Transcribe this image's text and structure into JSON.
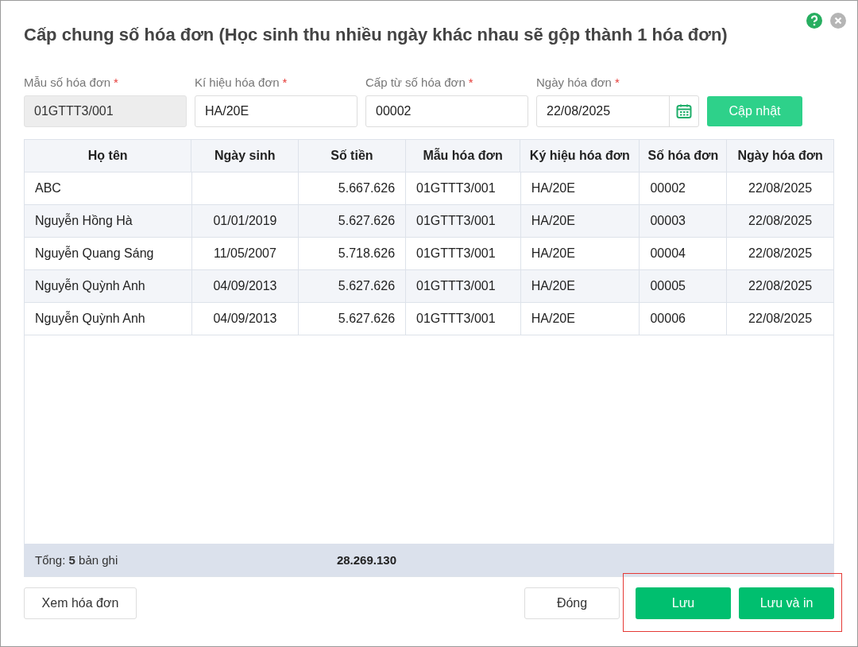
{
  "dialog": {
    "title": "Cấp chung số hóa đơn (Học sinh thu nhiều ngày khác nhau sẽ gộp thành 1 hóa đơn)"
  },
  "fields": [
    {
      "label": "Mẫu số hóa đơn",
      "required_mark": "*",
      "value": "01GTTT3/001",
      "disabled": true,
      "kind": "text"
    },
    {
      "label": "Kí hiệu hóa đơn",
      "required_mark": "*",
      "value": "HA/20E",
      "disabled": false,
      "kind": "text"
    },
    {
      "label": "Cấp từ số hóa đơn",
      "required_mark": "*",
      "value": "00002",
      "disabled": false,
      "kind": "text"
    },
    {
      "label": "Ngày hóa đơn",
      "required_mark": "*",
      "value": "22/08/2025",
      "disabled": false,
      "kind": "date"
    }
  ],
  "update_button": "Cập nhật",
  "table": {
    "columns": [
      {
        "label": "Họ tên"
      },
      {
        "label": "Ngày sinh"
      },
      {
        "label": "Số tiền"
      },
      {
        "label": "Mẫu hóa đơn"
      },
      {
        "label": "Ký hiệu hóa đơn"
      },
      {
        "label": "Số hóa đơn"
      },
      {
        "label": "Ngày hóa đơn"
      }
    ],
    "rows": [
      [
        "ABC",
        "",
        "5.667.626",
        "01GTTT3/001",
        "HA/20E",
        "00002",
        "22/08/2025"
      ],
      [
        "Nguyễn Hồng Hà",
        "01/01/2019",
        "5.627.626",
        "01GTTT3/001",
        "HA/20E",
        "00003",
        "22/08/2025"
      ],
      [
        "Nguyễn Quang Sáng",
        "11/05/2007",
        "5.718.626",
        "01GTTT3/001",
        "HA/20E",
        "00004",
        "22/08/2025"
      ],
      [
        "Nguyễn Quỳnh Anh",
        "04/09/2013",
        "5.627.626",
        "01GTTT3/001",
        "HA/20E",
        "00005",
        "22/08/2025"
      ],
      [
        "Nguyễn Quỳnh Anh",
        "04/09/2013",
        "5.627.626",
        "01GTTT3/001",
        "HA/20E",
        "00006",
        "22/08/2025"
      ]
    ],
    "summary": {
      "count_text": "Tổng: **5** bản ghi",
      "total": "28.269.130"
    }
  },
  "footer": {
    "left_button": "Xem hóa đơn",
    "buttons": [
      {
        "label": "Đóng",
        "kind": "secondary",
        "highlighted": false
      },
      {
        "label": "Lưu",
        "kind": "primary",
        "highlighted": true
      },
      {
        "label": "Lưu và in",
        "kind": "primary",
        "highlighted": true
      }
    ]
  }
}
